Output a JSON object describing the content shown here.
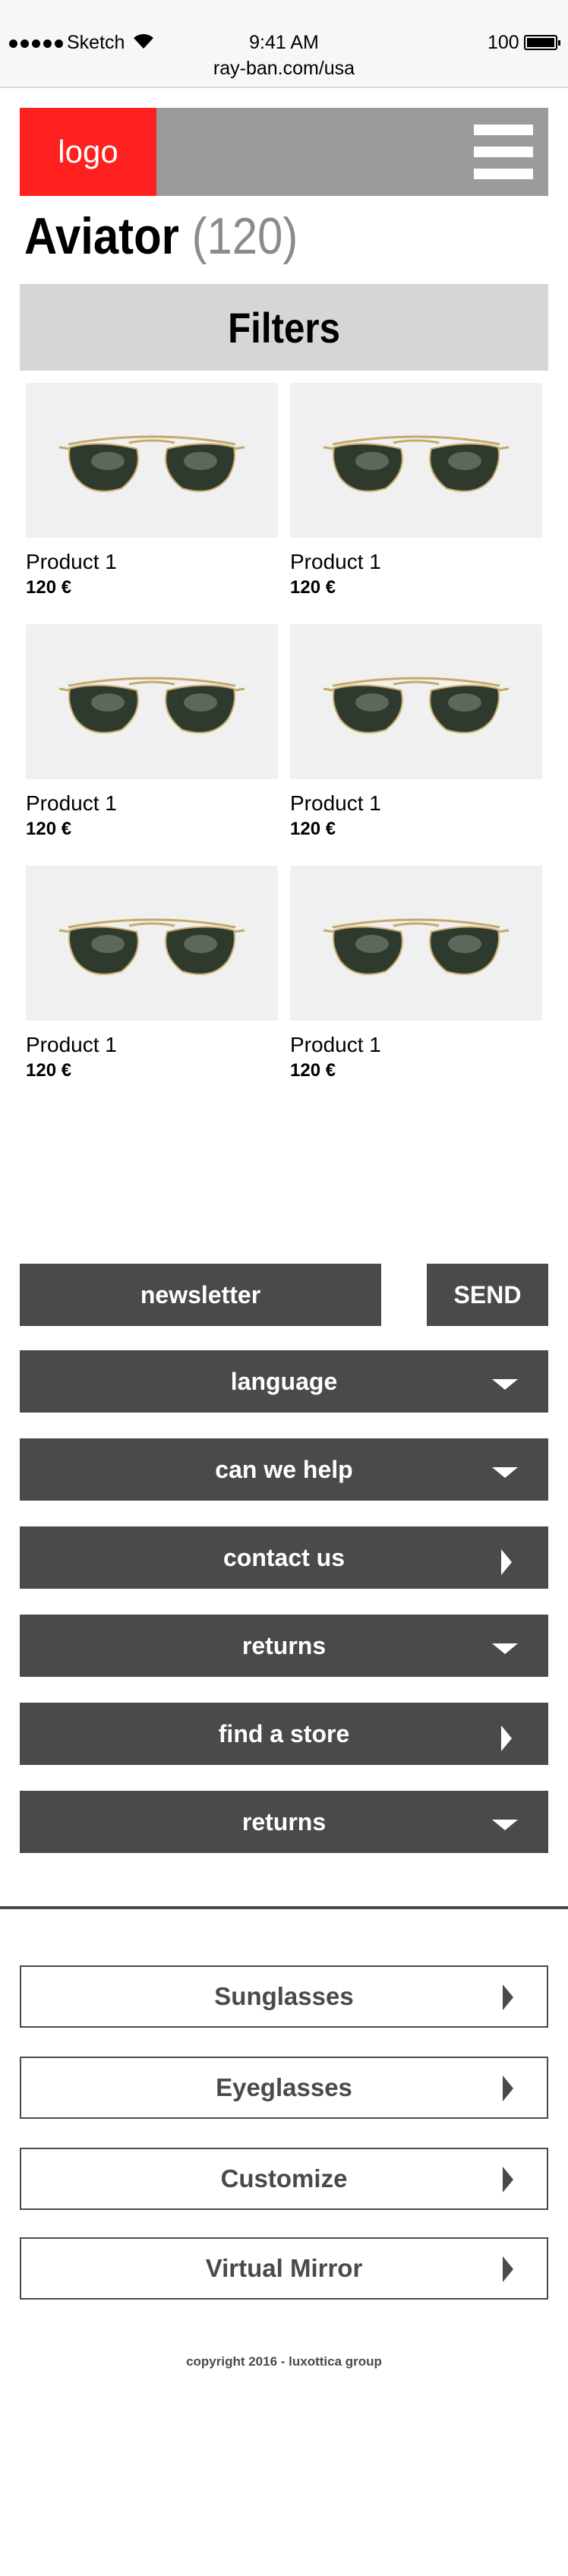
{
  "status_bar": {
    "carrier": "Sketch",
    "time": "9:41 AM",
    "battery": "100",
    "url": "ray-ban.com/usa"
  },
  "header": {
    "logo_label": "logo"
  },
  "page": {
    "title": "Aviator",
    "count": "(120)",
    "filters_label": "Filters"
  },
  "products": [
    {
      "name": "Product 1",
      "price": "120 €"
    },
    {
      "name": "Product 1",
      "price": "120 €"
    },
    {
      "name": "Product 1",
      "price": "120 €"
    },
    {
      "name": "Product 1",
      "price": "120 €"
    },
    {
      "name": "Product 1",
      "price": "120 €"
    },
    {
      "name": "Product 1",
      "price": "120 €"
    }
  ],
  "footer": {
    "newsletter_label": "newsletter",
    "send_label": "SEND",
    "accordion": [
      {
        "label": "language",
        "icon": "triangle-down-icon"
      },
      {
        "label": "can we help",
        "icon": "triangle-down-icon"
      },
      {
        "label": "contact us",
        "icon": "triangle-right-icon"
      },
      {
        "label": "returns",
        "icon": "triangle-down-icon"
      },
      {
        "label": "find a store",
        "icon": "triangle-right-icon"
      },
      {
        "label": "returns",
        "icon": "triangle-down-icon"
      }
    ],
    "categories": [
      {
        "label": "Sunglasses"
      },
      {
        "label": "Eyeglasses"
      },
      {
        "label": "Customize"
      },
      {
        "label": "Virtual Mirror"
      }
    ],
    "copyright": "copyright 2016 - luxottica group"
  },
  "colors": {
    "brand_red": "#ff2020",
    "header_gray": "#9b9b9b",
    "dark_gray": "#4a4a4a",
    "filters_gray": "#d6d6d6",
    "image_bg": "#f0f0f0"
  }
}
